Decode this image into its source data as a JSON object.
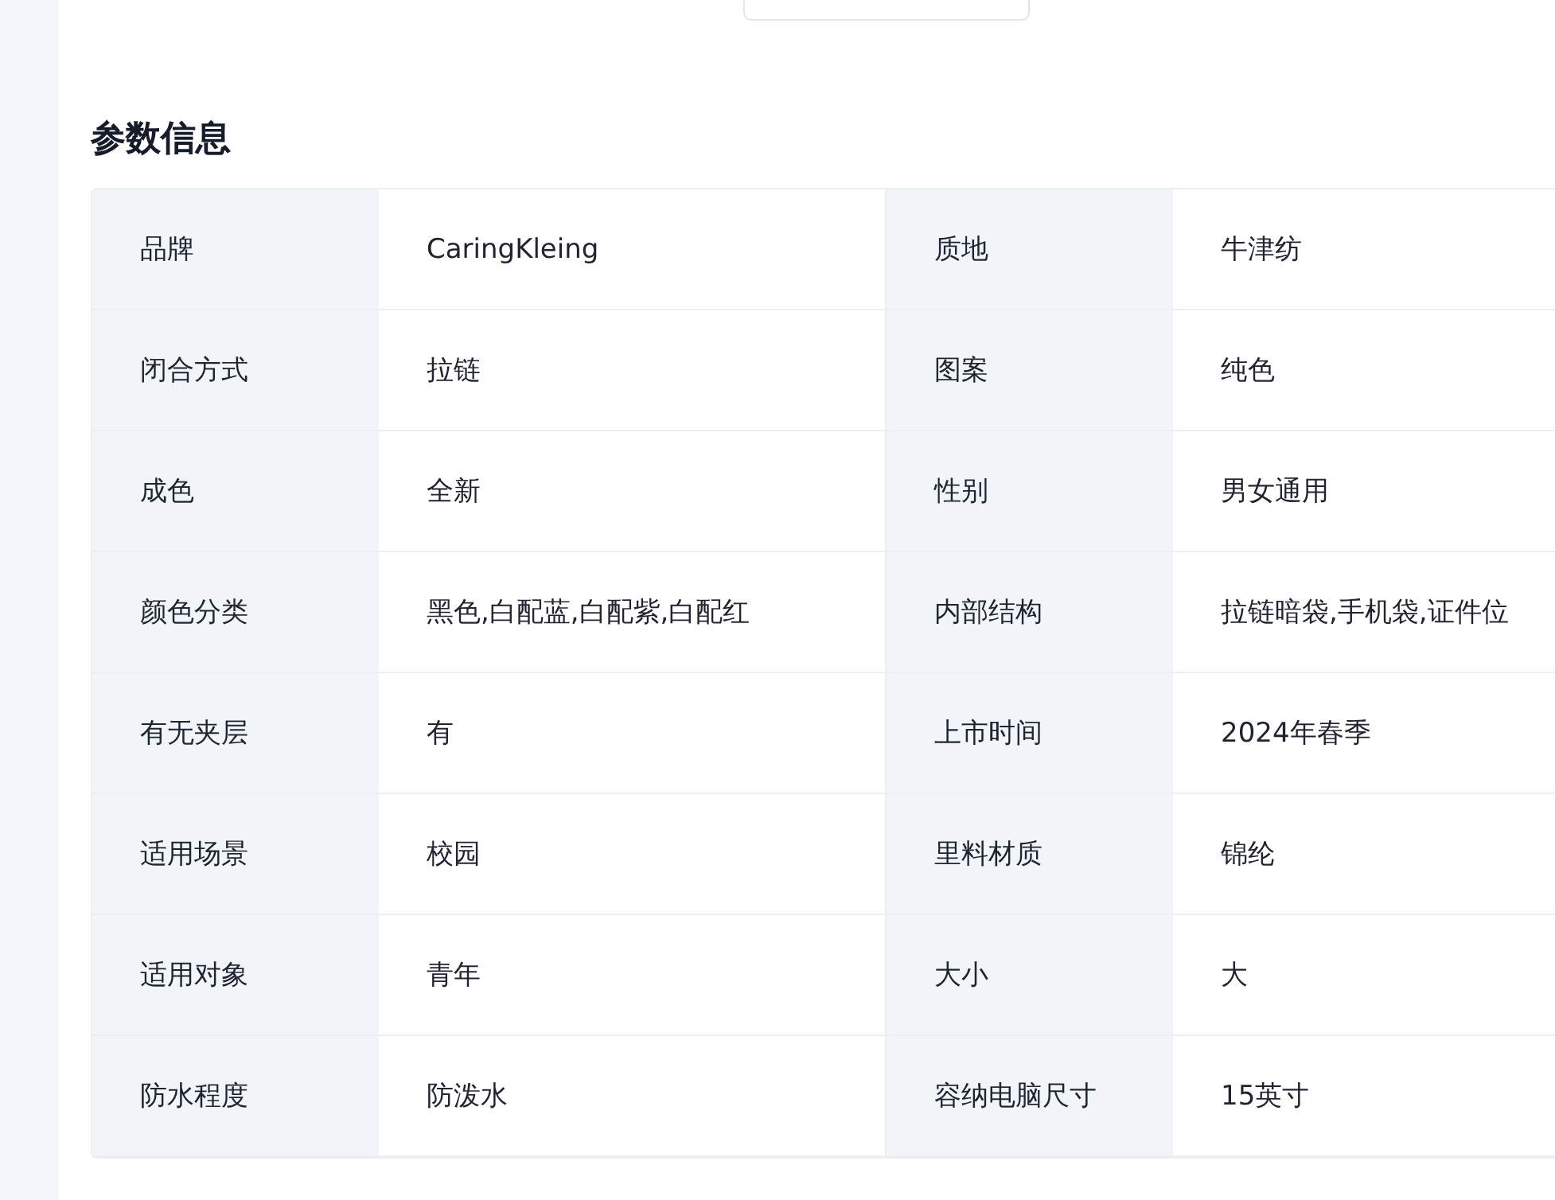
{
  "section_title": "参数信息",
  "params": [
    {
      "label": "品牌",
      "value": "CaringKleing"
    },
    {
      "label": "质地",
      "value": "牛津纺"
    },
    {
      "label": "闭合方式",
      "value": "拉链"
    },
    {
      "label": "图案",
      "value": "纯色"
    },
    {
      "label": "成色",
      "value": "全新"
    },
    {
      "label": "性别",
      "value": "男女通用"
    },
    {
      "label": "颜色分类",
      "value": "黑色,白配蓝,白配紫,白配红"
    },
    {
      "label": "内部结构",
      "value": "拉链暗袋,手机袋,证件位"
    },
    {
      "label": "有无夹层",
      "value": "有"
    },
    {
      "label": "上市时间",
      "value": "2024年春季"
    },
    {
      "label": "适用场景",
      "value": "校园"
    },
    {
      "label": "里料材质",
      "value": "锦纶"
    },
    {
      "label": "适用对象",
      "value": "青年"
    },
    {
      "label": "大小",
      "value": "大"
    },
    {
      "label": "防水程度",
      "value": "防泼水"
    },
    {
      "label": "容纳电脑尺寸",
      "value": "15英寸"
    }
  ]
}
